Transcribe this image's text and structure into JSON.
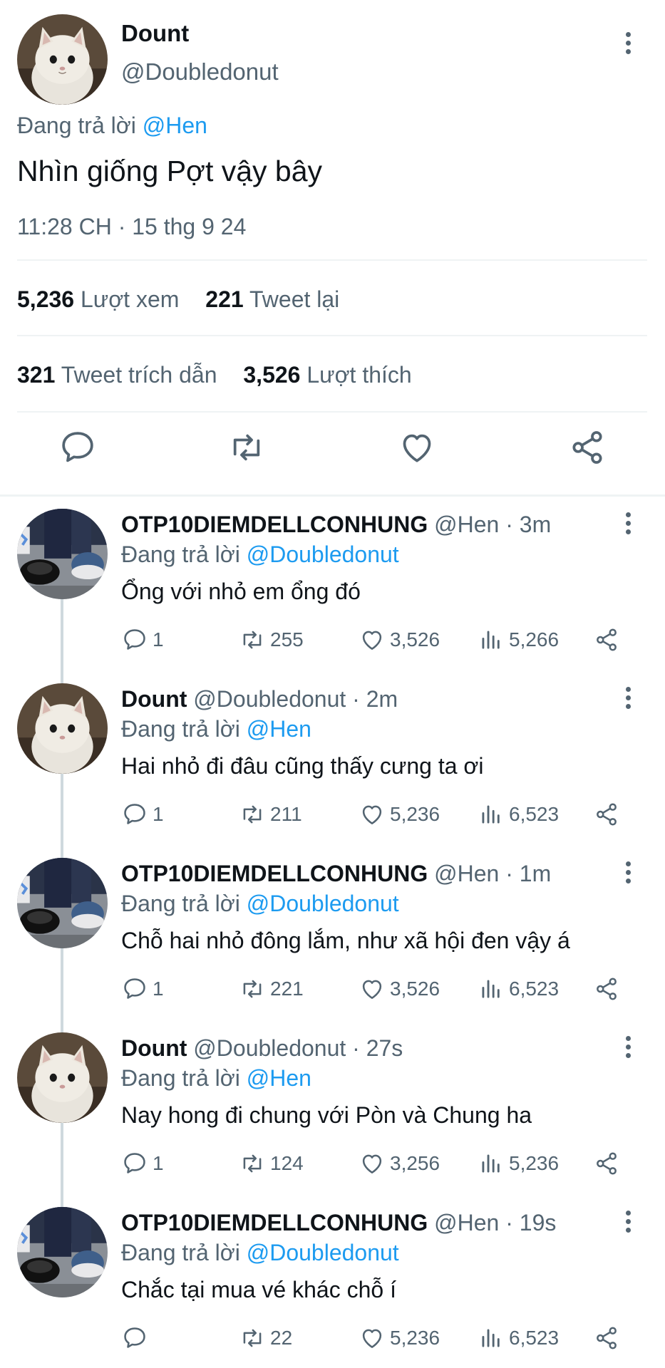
{
  "main_tweet": {
    "author_name": "Dount",
    "author_handle": "@Doubledonut",
    "replying_prefix": "Đang trả lời",
    "replying_to": "@Hen",
    "text": "Nhìn giống Pợt vậy bây",
    "timestamp": "11:28 CH · 15 thg 9 24",
    "views_count": "5,236",
    "views_label": "Lượt xem",
    "retweets_count": "221",
    "retweets_label": "Tweet lại",
    "quotes_count": "321",
    "quotes_label": "Tweet trích dẫn",
    "likes_count": "3,526",
    "likes_label": "Lượt thích",
    "icons": [
      "more-icon",
      "reply-icon",
      "retweet-icon",
      "like-icon",
      "share-icon"
    ]
  },
  "colors": {
    "accent": "#1d9bf0",
    "secondary_text": "#536471",
    "primary_text": "#0f1419",
    "divider": "#eff3f4"
  },
  "replies": [
    {
      "name": "OTP10DIEMDELLCONHUNG",
      "meta": "@Hen · 3m",
      "replying_prefix": "Đang trả lời",
      "replying_to": "@Doubledonut",
      "text": "Ổng với nhỏ em ổng đó",
      "replies": "1",
      "retweets": "255",
      "likes": "3,526",
      "views": "5,266",
      "avatar": "shoes"
    },
    {
      "name": "Dount",
      "meta": "@Doubledonut · 2m",
      "replying_prefix": "Đang trả lời",
      "replying_to": "@Hen",
      "text": "Hai nhỏ đi đâu cũng thấy cưng ta ơi",
      "replies": "1",
      "retweets": "211",
      "likes": "5,236",
      "views": "6,523",
      "avatar": "cat"
    },
    {
      "name": "OTP10DIEMDELLCONHUNG",
      "meta": "@Hen · 1m",
      "replying_prefix": "Đang trả lời",
      "replying_to": "@Doubledonut",
      "text": "Chỗ hai nhỏ đông lắm, như xã hội đen vậy á",
      "replies": "1",
      "retweets": "221",
      "likes": "3,526",
      "views": "6,523",
      "avatar": "shoes"
    },
    {
      "name": "Dount",
      "meta": "@Doubledonut · 27s",
      "replying_prefix": "Đang trả lời",
      "replying_to": "@Hen",
      "text": "Nay hong đi chung với Pòn và Chung ha",
      "replies": "1",
      "retweets": "124",
      "likes": "3,256",
      "views": "5,236",
      "avatar": "cat"
    },
    {
      "name": "OTP10DIEMDELLCONHUNG",
      "meta": "@Hen · 19s",
      "replying_prefix": "Đang trả lời",
      "replying_to": "@Doubledonut",
      "text": "Chắc tại mua vé khác chỗ í",
      "replies": "",
      "retweets": "22",
      "likes": "5,236",
      "views": "6,523",
      "avatar": "shoes"
    }
  ]
}
